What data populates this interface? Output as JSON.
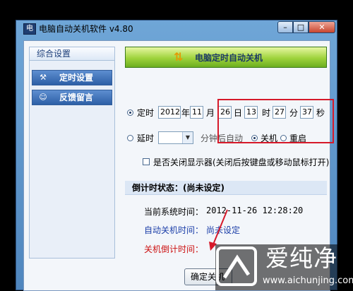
{
  "window": {
    "title": "电脑自动关机软件 v4.80",
    "icon_text": "电"
  },
  "titlebar_buttons": {
    "minimize": "–",
    "maximize": "□",
    "close": "✕"
  },
  "sidebar": {
    "header": "综合设置",
    "items": [
      {
        "label": "定时设置",
        "icon": "tools-icon",
        "selected": true
      },
      {
        "label": "反馈留言",
        "icon": "person-icon",
        "selected": false
      }
    ]
  },
  "banner": {
    "text": "电脑定时自动关机",
    "icon": "arrows-icon"
  },
  "schedule": {
    "timed_label": "定时",
    "year": "2012",
    "year_unit": "年",
    "month": "11",
    "month_unit": "月",
    "day": "26",
    "day_unit": "日",
    "hour": "13",
    "hour_unit": "时",
    "minute": "27",
    "minute_unit": "分",
    "second": "37",
    "second_unit": "秒",
    "delay_label": "延时",
    "delay_value": "",
    "delay_suffix": "分钟后自动",
    "action_shutdown": "关机",
    "action_restart": "重启",
    "monitor_off_label": "是否关闭显示器(关闭后按键盘或移动鼠标打开)"
  },
  "countdown": {
    "header": "倒计时状态：(尚未设定)",
    "current_time_label": "当前系统时间：",
    "current_time_value": "2012-11-26 12:28:20",
    "auto_shutdown_label": "自动关机时间：",
    "auto_shutdown_value": "尚未设定",
    "countdown_label": "关机倒计时间："
  },
  "confirm_button": "确定关机",
  "watermark": {
    "brand": "爱纯净",
    "url": "www.aichunjing.com"
  },
  "colors": {
    "highlight_box": "#d6192a",
    "sidebar_selected": "#2d5fa6",
    "banner_green": "#9ed33c",
    "link_blue": "#1b3ea8",
    "alert_red": "#cc1111"
  }
}
